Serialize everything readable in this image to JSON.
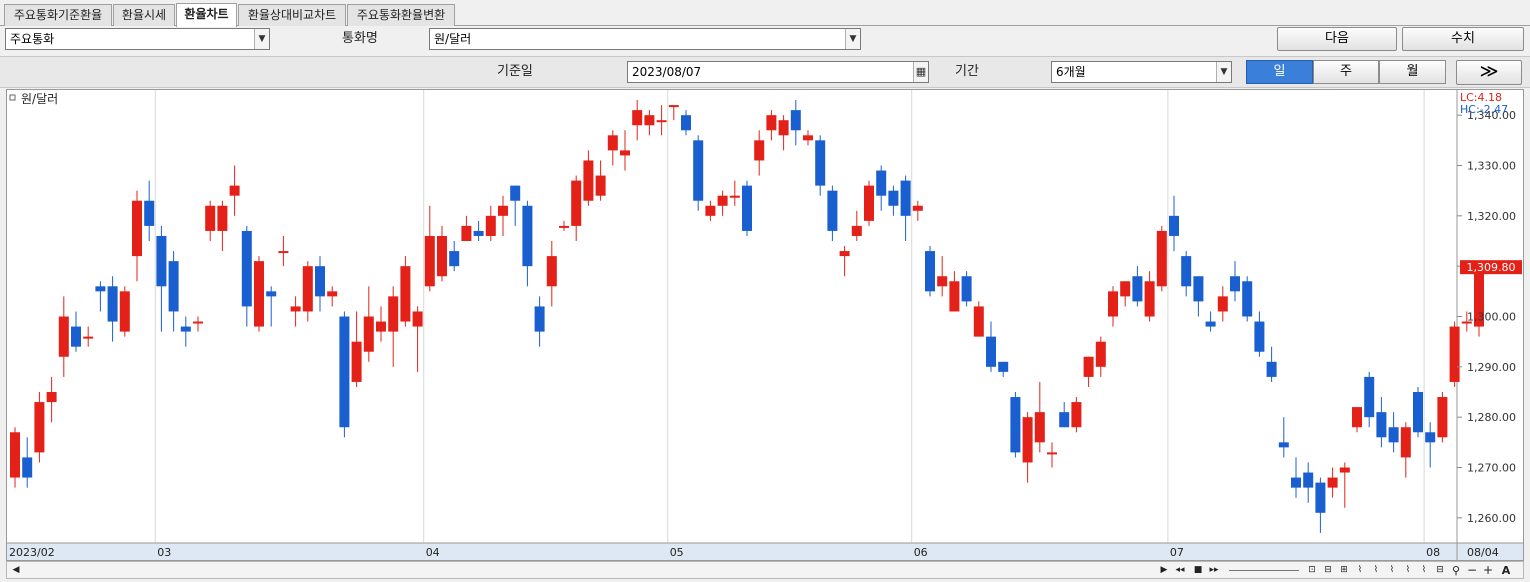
{
  "tabs": [
    {
      "label": "주요통화기준환율"
    },
    {
      "label": "환율시세"
    },
    {
      "label": "환율차트"
    },
    {
      "label": "환율상대비교차트"
    },
    {
      "label": "주요통화환율변환"
    }
  ],
  "toolbar": {
    "currency_group": "주요통화",
    "currency_name_label": "통화명",
    "currency_name": "원/달러",
    "next_button": "다음",
    "value_button": "수치",
    "base_date_label": "기준일",
    "base_date": "2023/08/07",
    "period_label": "기간",
    "period": "6개월",
    "interval_day": "일",
    "interval_week": "주",
    "interval_month": "월",
    "forward_button": "≫"
  },
  "chart_data": {
    "type": "candlestick",
    "legend": "원/달러",
    "lc_text": "LC:4.18",
    "hc_text": "HC:-2.47",
    "last_value_label": "1,309.80",
    "last_value": 1309.8,
    "ylim": [
      1255,
      1345
    ],
    "yticks": [
      1260,
      1270,
      1280,
      1290,
      1300,
      1310,
      1320,
      1330,
      1340
    ],
    "ytick_labels": [
      "1,260.00",
      "1,270.00",
      "1,280.00",
      "1,290.00",
      "1,300.00",
      "1,310.00",
      "1,320.00",
      "1,330.00",
      "1,340.00"
    ],
    "month_labels": [
      {
        "label": "2023/02",
        "index": 0
      },
      {
        "label": "03",
        "index": 12
      },
      {
        "label": "04",
        "index": 34
      },
      {
        "label": "05",
        "index": 54
      },
      {
        "label": "06",
        "index": 74
      },
      {
        "label": "07",
        "index": 95
      },
      {
        "label": "08",
        "index": 116
      }
    ],
    "x_end_label": "08/04",
    "colors": {
      "up": "#e32119",
      "down": "#1a5fcf",
      "grid": "#d8d8d8"
    },
    "candles": [
      [
        1268,
        1277,
        1266,
        1278
      ],
      [
        1272,
        1268,
        1266,
        1276
      ],
      [
        1273,
        1283,
        1271,
        1285
      ],
      [
        1283,
        1285,
        1279,
        1288
      ],
      [
        1292,
        1300,
        1288,
        1304
      ],
      [
        1298,
        1294,
        1293,
        1301
      ],
      [
        1296,
        1296,
        1294,
        1298
      ],
      [
        1306,
        1305,
        1301,
        1307
      ],
      [
        1306,
        1299,
        1295,
        1308
      ],
      [
        1297,
        1305,
        1296,
        1306
      ],
      [
        1312,
        1323,
        1307,
        1325
      ],
      [
        1323,
        1318,
        1315,
        1327
      ],
      [
        1316,
        1306,
        1297,
        1318
      ],
      [
        1311,
        1301,
        1297,
        1313
      ],
      [
        1298,
        1297,
        1294,
        1300
      ],
      [
        1299,
        1299,
        1297,
        1300
      ],
      [
        1317,
        1322,
        1315,
        1323
      ],
      [
        1317,
        1322,
        1313,
        1323
      ],
      [
        1324,
        1326,
        1320,
        1330
      ],
      [
        1317,
        1302,
        1298,
        1318
      ],
      [
        1298,
        1311,
        1297,
        1312
      ],
      [
        1305,
        1304,
        1298,
        1306
      ],
      [
        1313,
        1313,
        1310,
        1316
      ],
      [
        1301,
        1302,
        1298,
        1304
      ],
      [
        1301,
        1310,
        1299,
        1311
      ],
      [
        1310,
        1304,
        1301,
        1312
      ],
      [
        1304,
        1305,
        1302,
        1306
      ],
      [
        1300,
        1278,
        1276,
        1301
      ],
      [
        1287,
        1295,
        1286,
        1301
      ],
      [
        1293,
        1300,
        1291,
        1306
      ],
      [
        1297,
        1299,
        1295,
        1302
      ],
      [
        1297,
        1304,
        1290,
        1306
      ],
      [
        1299,
        1310,
        1298,
        1312
      ],
      [
        1298,
        1301,
        1289,
        1302
      ],
      [
        1306,
        1316,
        1305,
        1322
      ],
      [
        1308,
        1316,
        1307,
        1318
      ],
      [
        1313,
        1310,
        1309,
        1315
      ],
      [
        1315,
        1318,
        1315,
        1320
      ],
      [
        1317,
        1316,
        1315,
        1319
      ],
      [
        1316,
        1320,
        1315,
        1322
      ],
      [
        1320,
        1322,
        1316,
        1324
      ],
      [
        1326,
        1323,
        1318,
        1326
      ],
      [
        1322,
        1310,
        1306,
        1323
      ],
      [
        1302,
        1297,
        1294,
        1304
      ],
      [
        1306,
        1312,
        1302,
        1315
      ],
      [
        1318,
        1318,
        1317,
        1319
      ],
      [
        1318,
        1327,
        1315,
        1328
      ],
      [
        1323,
        1331,
        1322,
        1333
      ],
      [
        1324,
        1328,
        1323,
        1331
      ],
      [
        1333,
        1336,
        1330,
        1337
      ],
      [
        1332,
        1333,
        1329,
        1337
      ],
      [
        1338,
        1341,
        1335,
        1343
      ],
      [
        1338,
        1340,
        1336,
        1341
      ],
      [
        1339,
        1339,
        1336,
        1342
      ],
      [
        1342,
        1342,
        1339,
        1342
      ],
      [
        1340,
        1337,
        1336,
        1341
      ],
      [
        1335,
        1323,
        1321,
        1336
      ],
      [
        1320,
        1322,
        1319,
        1323
      ],
      [
        1322,
        1324,
        1320,
        1325
      ],
      [
        1324,
        1324,
        1322,
        1327
      ],
      [
        1326,
        1317,
        1316,
        1327
      ],
      [
        1331,
        1335,
        1328,
        1337
      ],
      [
        1337,
        1340,
        1335,
        1341
      ],
      [
        1336,
        1339,
        1333,
        1340
      ],
      [
        1341,
        1337,
        1334,
        1343
      ],
      [
        1335,
        1336,
        1334,
        1337
      ],
      [
        1335,
        1326,
        1324,
        1336
      ],
      [
        1325,
        1317,
        1315,
        1326
      ],
      [
        1312,
        1313,
        1308,
        1314
      ],
      [
        1316,
        1318,
        1315,
        1321
      ],
      [
        1319,
        1326,
        1318,
        1327
      ],
      [
        1329,
        1324,
        1321,
        1330
      ],
      [
        1325,
        1322,
        1320,
        1326
      ],
      [
        1327,
        1320,
        1315,
        1328
      ],
      [
        1321,
        1322,
        1319,
        1323
      ],
      [
        1313,
        1305,
        1304,
        1314
      ],
      [
        1306,
        1308,
        1304,
        1312
      ],
      [
        1301,
        1307,
        1301,
        1309
      ],
      [
        1308,
        1303,
        1302,
        1309
      ],
      [
        1296,
        1302,
        1296,
        1303
      ],
      [
        1296,
        1290,
        1289,
        1299
      ],
      [
        1291,
        1289,
        1288,
        1291
      ],
      [
        1284,
        1273,
        1272,
        1285
      ],
      [
        1271,
        1280,
        1267,
        1281
      ],
      [
        1275,
        1281,
        1273,
        1287
      ],
      [
        1273,
        1273,
        1270,
        1275
      ],
      [
        1281,
        1278,
        1278,
        1283
      ],
      [
        1278,
        1283,
        1277,
        1284
      ],
      [
        1288,
        1292,
        1286,
        1292
      ],
      [
        1290,
        1295,
        1288,
        1296
      ],
      [
        1300,
        1305,
        1298,
        1306
      ],
      [
        1304,
        1307,
        1302,
        1307
      ],
      [
        1308,
        1303,
        1302,
        1310
      ],
      [
        1300,
        1307,
        1299,
        1309
      ],
      [
        1306,
        1317,
        1305,
        1318
      ],
      [
        1320,
        1316,
        1313,
        1324
      ],
      [
        1312,
        1306,
        1304,
        1313
      ],
      [
        1308,
        1303,
        1300,
        1308
      ],
      [
        1299,
        1298,
        1297,
        1301
      ],
      [
        1301,
        1304,
        1299,
        1306
      ],
      [
        1308,
        1305,
        1303,
        1311
      ],
      [
        1307,
        1300,
        1299,
        1308
      ],
      [
        1299,
        1293,
        1292,
        1301
      ],
      [
        1291,
        1288,
        1287,
        1294
      ],
      [
        1275,
        1274,
        1272,
        1280
      ],
      [
        1268,
        1266,
        1264,
        1272
      ],
      [
        1269,
        1266,
        1263,
        1271
      ],
      [
        1267,
        1261,
        1257,
        1268
      ],
      [
        1266,
        1268,
        1264,
        1270
      ],
      [
        1269,
        1270,
        1262,
        1271
      ],
      [
        1278,
        1282,
        1277,
        1282
      ],
      [
        1288,
        1280,
        1278,
        1289
      ],
      [
        1281,
        1276,
        1274,
        1284
      ],
      [
        1278,
        1275,
        1273,
        1281
      ],
      [
        1272,
        1278,
        1268,
        1279
      ],
      [
        1285,
        1277,
        1276,
        1286
      ],
      [
        1277,
        1275,
        1270,
        1279
      ],
      [
        1276,
        1284,
        1275,
        1285
      ],
      [
        1287,
        1298,
        1286,
        1299
      ],
      [
        1299,
        1299,
        1297,
        1301
      ],
      [
        1298,
        1310,
        1296,
        1311
      ]
    ]
  }
}
